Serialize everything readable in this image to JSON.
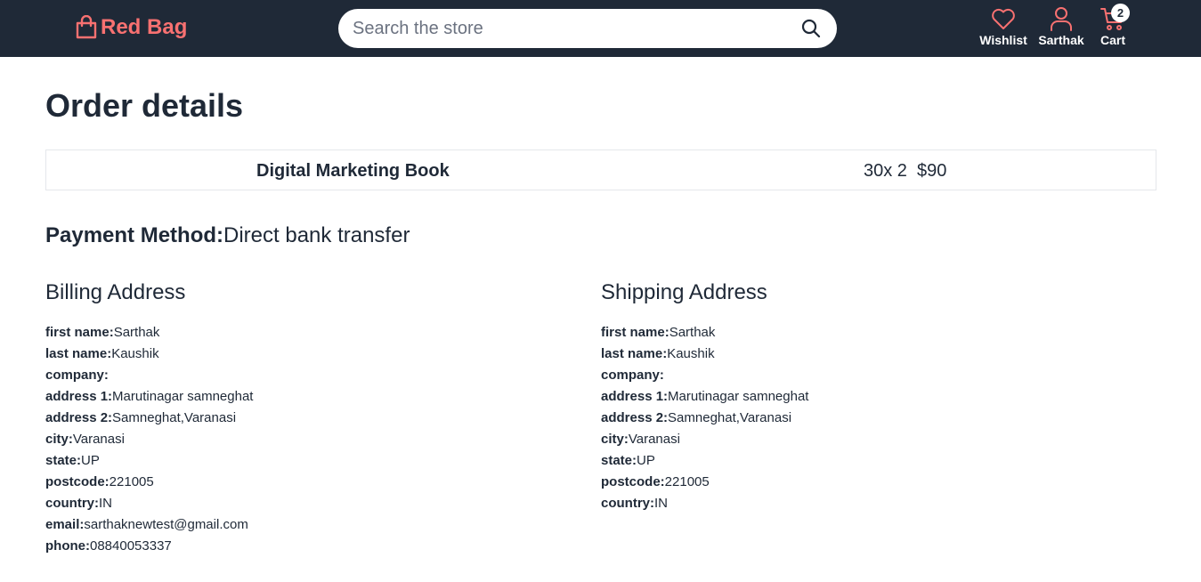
{
  "header": {
    "brand": "Red Bag",
    "search_placeholder": "Search the store",
    "wishlist_label": "Wishlist",
    "account_label": "Sarthak",
    "cart_label": "Cart",
    "cart_count": "2"
  },
  "page": {
    "title": "Order details"
  },
  "order": {
    "items": [
      {
        "name": "Digital Marketing Book",
        "qty": "30x 2",
        "price": "$90"
      }
    ]
  },
  "payment": {
    "label": "Payment Method:",
    "value": "Direct bank transfer"
  },
  "billing": {
    "heading": "Billing Address",
    "fields": [
      {
        "key": "first name:",
        "value": "Sarthak"
      },
      {
        "key": "last name:",
        "value": "Kaushik"
      },
      {
        "key": "company:",
        "value": ""
      },
      {
        "key": "address 1:",
        "value": "Marutinagar samneghat"
      },
      {
        "key": "address 2:",
        "value": "Samneghat,Varanasi"
      },
      {
        "key": "city:",
        "value": "Varanasi"
      },
      {
        "key": "state:",
        "value": "UP"
      },
      {
        "key": "postcode:",
        "value": "221005"
      },
      {
        "key": "country:",
        "value": "IN"
      },
      {
        "key": "email:",
        "value": "sarthaknewtest@gmail.com"
      },
      {
        "key": "phone:",
        "value": "08840053337"
      }
    ]
  },
  "shipping": {
    "heading": "Shipping Address",
    "fields": [
      {
        "key": "first name:",
        "value": "Sarthak"
      },
      {
        "key": "last name:",
        "value": "Kaushik"
      },
      {
        "key": "company:",
        "value": ""
      },
      {
        "key": "address 1:",
        "value": "Marutinagar samneghat"
      },
      {
        "key": "address 2:",
        "value": "Samneghat,Varanasi"
      },
      {
        "key": "city:",
        "value": "Varanasi"
      },
      {
        "key": "state:",
        "value": "UP"
      },
      {
        "key": "postcode:",
        "value": "221005"
      },
      {
        "key": "country:",
        "value": "IN"
      }
    ]
  },
  "colors": {
    "navbar_bg": "#1f2937",
    "brand": "#f87171",
    "text": "#1f2937",
    "border": "#e5e7eb"
  },
  "icons": {
    "brand": "shopping-bag-icon",
    "search": "search-icon",
    "wishlist": "heart-icon",
    "account": "user-icon",
    "cart": "cart-icon"
  }
}
